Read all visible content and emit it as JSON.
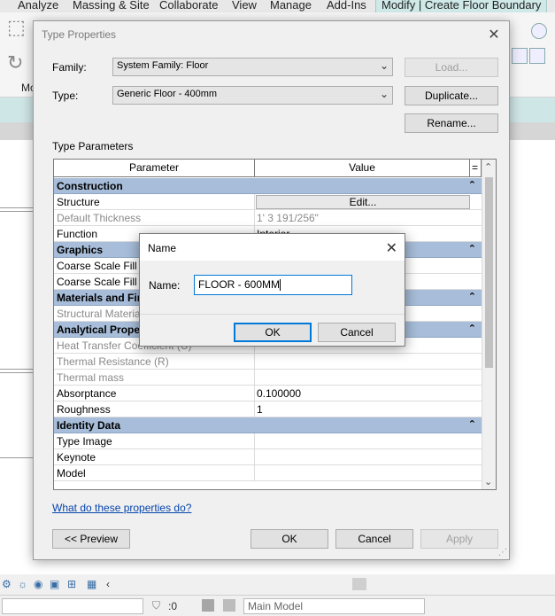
{
  "ribbon": {
    "tabs": [
      {
        "label": "Analyze"
      },
      {
        "label": "Massing & Site"
      },
      {
        "label": "Collaborate"
      },
      {
        "label": "View"
      },
      {
        "label": "Manage"
      },
      {
        "label": "Add-Ins"
      },
      {
        "label": "Modify | Create Floor Boundary"
      }
    ],
    "left_label": "Mc"
  },
  "status_bar": {
    "selection_count": ":0",
    "model": "Main Model"
  },
  "type_properties": {
    "title": "Type Properties",
    "family_label": "Family:",
    "family_value": "System Family: Floor",
    "type_label": "Type:",
    "type_value": "Generic Floor - 400mm",
    "load_button": "Load...",
    "duplicate_button": "Duplicate...",
    "rename_button": "Rename...",
    "type_parameters_label": "Type Parameters",
    "grid": {
      "col_parameter": "Parameter",
      "col_value": "Value",
      "col_eq": "=",
      "rows": [
        {
          "kind": "group",
          "name": "Construction"
        },
        {
          "kind": "param",
          "name": "Structure",
          "value": "Edit..."
        },
        {
          "kind": "param",
          "name": "Default Thickness",
          "value": "1'  3 191/256\"",
          "dim": true
        },
        {
          "kind": "param",
          "name": "Function",
          "value": "Interior"
        },
        {
          "kind": "group",
          "name": "Graphics"
        },
        {
          "kind": "param",
          "name": "Coarse Scale Fill Pattern",
          "value": ""
        },
        {
          "kind": "param",
          "name": "Coarse Scale Fill Color",
          "value": ""
        },
        {
          "kind": "group",
          "name": "Materials and Finishes"
        },
        {
          "kind": "param",
          "name": "Structural Material",
          "value": "",
          "dim": true
        },
        {
          "kind": "group",
          "name": "Analytical Properties"
        },
        {
          "kind": "param",
          "name": "Heat Transfer Coefficient (U)",
          "value": "",
          "dim": true
        },
        {
          "kind": "param",
          "name": "Thermal Resistance (R)",
          "value": "",
          "dim": true
        },
        {
          "kind": "param",
          "name": "Thermal mass",
          "value": "",
          "dim": true
        },
        {
          "kind": "param",
          "name": "Absorptance",
          "value": "0.100000"
        },
        {
          "kind": "param",
          "name": "Roughness",
          "value": "1"
        },
        {
          "kind": "group",
          "name": "Identity Data"
        },
        {
          "kind": "param",
          "name": "Type Image",
          "value": ""
        },
        {
          "kind": "param",
          "name": "Keynote",
          "value": ""
        },
        {
          "kind": "param",
          "name": "Model",
          "value": ""
        }
      ]
    },
    "help_link": "What do these properties do?",
    "preview_button": "<< Preview",
    "ok_button": "OK",
    "cancel_button": "Cancel",
    "apply_button": "Apply"
  },
  "name_dialog": {
    "title": "Name",
    "name_label": "Name:",
    "name_value": "FLOOR - 600MM",
    "ok_button": "OK",
    "cancel_button": "Cancel"
  }
}
